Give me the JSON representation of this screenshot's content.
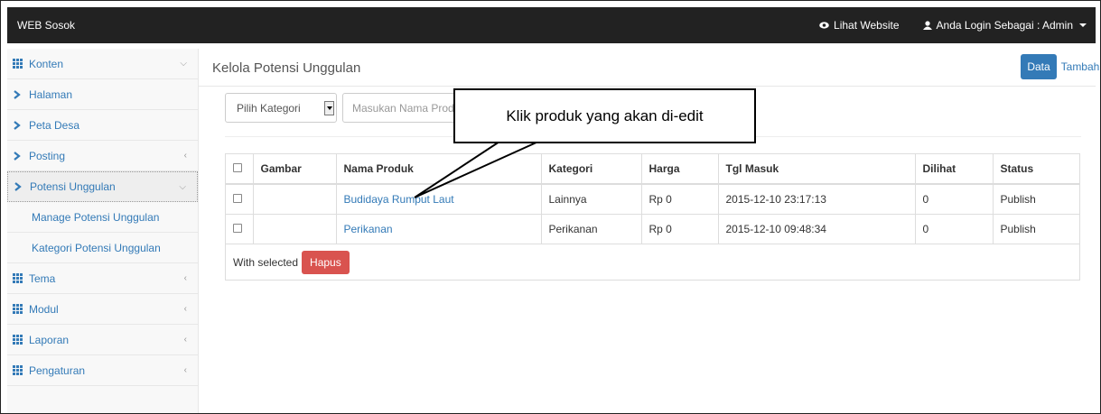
{
  "topbar": {
    "brand": "WEB Sosok",
    "view_site": "Lihat Website",
    "login_as": "Anda Login Sebagai : Admin"
  },
  "sidebar": {
    "items": [
      {
        "label": "Konten",
        "icon": "grid-icon",
        "arrow": "chevron-down"
      },
      {
        "label": "Halaman",
        "icon": "chevron-right-icon"
      },
      {
        "label": "Peta Desa",
        "icon": "chevron-right-icon"
      },
      {
        "label": "Posting",
        "icon": "chevron-right-icon",
        "arrow": "chevron-left"
      },
      {
        "label": "Potensi Unggulan",
        "icon": "chevron-right-icon",
        "arrow": "chevron-down"
      },
      {
        "label": "Manage Potensi Unggulan"
      },
      {
        "label": "Kategori Potensi Unggulan"
      },
      {
        "label": "Tema",
        "icon": "grid-icon",
        "arrow": "chevron-left"
      },
      {
        "label": "Modul",
        "icon": "grid-icon",
        "arrow": "chevron-left"
      },
      {
        "label": "Laporan",
        "icon": "grid-icon",
        "arrow": "chevron-left"
      },
      {
        "label": "Pengaturan",
        "icon": "grid-icon",
        "arrow": "chevron-left"
      }
    ]
  },
  "main": {
    "title": "Kelola Potensi Unggulan",
    "btn_data": "Data",
    "btn_tambah": "Tambah",
    "filter_select": "Pilih Kategori",
    "search_placeholder": "Masukan Nama Produk",
    "table": {
      "headers": [
        "Gambar",
        "Nama Produk",
        "Kategori",
        "Harga",
        "Tgl Masuk",
        "Dilihat",
        "Status"
      ],
      "rows": [
        {
          "gambar": "",
          "nama": "Budidaya Rumput Laut",
          "kategori": "Lainnya",
          "harga": "Rp 0",
          "tgl": "2015-12-10 23:17:13",
          "dilihat": "0",
          "status": "Publish"
        },
        {
          "gambar": "",
          "nama": "Perikanan",
          "kategori": "Perikanan",
          "harga": "Rp 0",
          "tgl": "2015-12-10 09:48:34",
          "dilihat": "0",
          "status": "Publish"
        }
      ]
    },
    "with_selected": "With selected",
    "btn_hapus": "Hapus"
  },
  "callout": {
    "text": "Klik produk yang akan di-edit"
  },
  "colors": {
    "primary": "#337ab7",
    "danger": "#d9534f",
    "navbar": "#222222"
  }
}
